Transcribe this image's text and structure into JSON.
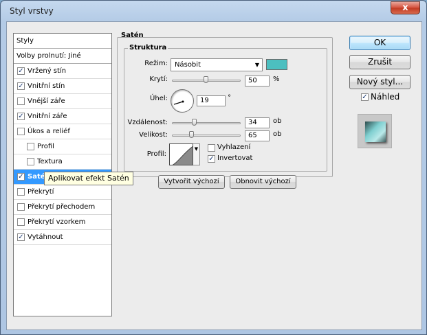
{
  "window": {
    "title": "Styl vrstvy",
    "close_glyph": "x"
  },
  "left_list": {
    "items": [
      {
        "label": "Styly",
        "checked": null
      },
      {
        "label": "Volby prolnutí: Jiné",
        "checked": null
      },
      {
        "label": "Vržený stín",
        "checked": true
      },
      {
        "label": "Vnitřní stín",
        "checked": true
      },
      {
        "label": "Vnější záře",
        "checked": false
      },
      {
        "label": "Vnitřní záře",
        "checked": true
      },
      {
        "label": "Úkos a reliéf",
        "checked": false
      },
      {
        "label": "Profil",
        "checked": false
      },
      {
        "label": "Textura",
        "checked": false
      },
      {
        "label": "Satén",
        "checked": true
      },
      {
        "label": "Překrytí",
        "checked": false
      },
      {
        "label": "Překrytí přechodem",
        "checked": false
      },
      {
        "label": "Překrytí vzorkem",
        "checked": false
      },
      {
        "label": "Vytáhnout",
        "checked": true
      }
    ]
  },
  "tooltip": "Aplikovat efekt Satén",
  "satin": {
    "group_title": "Satén",
    "structure_title": "Struktura",
    "mode_label": "Režim:",
    "mode_value": "Násobit",
    "color": "#4cbfc0",
    "opacity_label": "Krytí:",
    "opacity_value": "50",
    "opacity_unit": "%",
    "angle_label": "Úhel:",
    "angle_value": "19",
    "angle_unit": "°",
    "distance_label": "Vzdálenost:",
    "distance_value": "34",
    "distance_unit": "ob",
    "size_label": "Velikost:",
    "size_value": "65",
    "size_unit": "ob",
    "profile_label": "Profil:",
    "antialias_label": "Vyhlazení",
    "antialias_checked": false,
    "invert_label": "Invertovat",
    "invert_checked": true,
    "make_default": "Vytvořit výchozí",
    "reset_default": "Obnovit výchozí"
  },
  "actions": {
    "ok": "OK",
    "cancel": "Zrušit",
    "new_style": "Nový styl...",
    "preview_label": "Náhled",
    "preview_checked": true
  }
}
